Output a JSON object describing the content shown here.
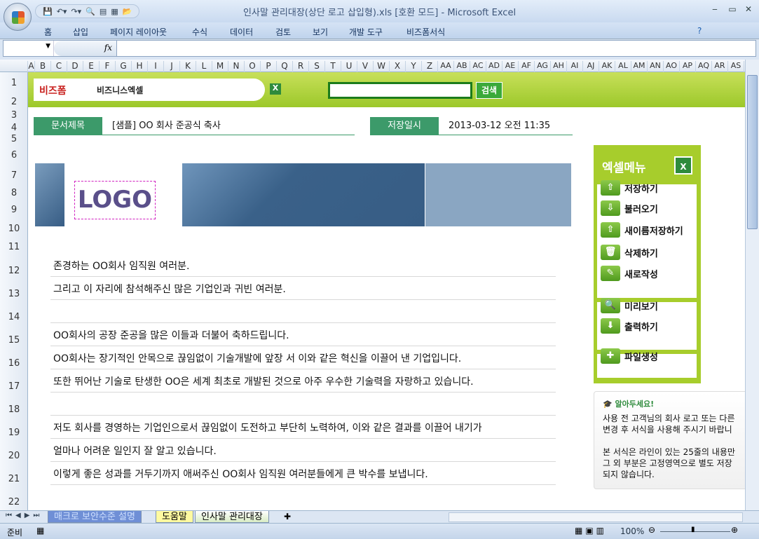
{
  "window": {
    "title": "인사말 관리대장(상단 로고 삽입형).xls  [호환 모드] - Microsoft Excel",
    "min": "‒",
    "max": "▭",
    "close": "✕"
  },
  "ribbon": {
    "tabs": [
      "홈",
      "삽입",
      "페이지 레이아웃",
      "수식",
      "데이터",
      "검토",
      "보기",
      "개발 도구",
      "비즈폼서식"
    ]
  },
  "formula_bar": {
    "name_box": "",
    "fx": "fx",
    "value": ""
  },
  "columns": [
    "A",
    "B",
    "C",
    "D",
    "E",
    "F",
    "G",
    "H",
    "I",
    "J",
    "K",
    "L",
    "M",
    "N",
    "O",
    "P",
    "Q",
    "R",
    "S",
    "T",
    "U",
    "V",
    "W",
    "X",
    "Y",
    "Z",
    "AA",
    "AB",
    "AC",
    "AD",
    "AE",
    "AF",
    "AG",
    "AH",
    "AI",
    "AJ",
    "AK",
    "AL",
    "AM",
    "AN",
    "AO",
    "AP",
    "AQ",
    "AR",
    "AS"
  ],
  "rows": [
    "1",
    "2",
    "3",
    "4",
    "5",
    "6",
    "7",
    "8",
    "9",
    "10",
    "11",
    "12",
    "13",
    "14",
    "15",
    "16",
    "17",
    "18",
    "19",
    "20",
    "21",
    "22"
  ],
  "banner": {
    "brand": "비즈폼",
    "brand2": "비즈니스엑셀",
    "title": "엑셀데이터 서식",
    "search_value": "",
    "search_button": "검색"
  },
  "doc": {
    "title_label": "문서제목",
    "title_value": "[샘플] OO 회사 준공식 축사",
    "date_label": "저장일시",
    "date_value": "2013-03-12  오전 11:35",
    "logo": "LOGO"
  },
  "lines": [
    "존경하는 OO회사 임직원 여러분.",
    "그리고 이 자리에 참석해주신 많은 기업인과 귀빈 여러분.",
    "",
    "OO회사의 공장 준공을 많은 이들과 더불어 축하드립니다.",
    "OO회사는 장기적인 안목으로 끊임없이 기술개발에 앞장 서 이와 같은 혁신을 이끌어 낸 기업입니다.",
    "또한 뛰어난 기술로 탄생한 OO은 세계 최초로 개발된 것으로 아주 우수한 기술력을 자랑하고 있습니다.",
    "",
    "저도 회사를 경영하는 기업인으로서 끊임없이 도전하고 부단히 노력하여, 이와 같은 결과를 이끌어 내기가",
    "얼마나 어려운 일인지 잘 알고 있습니다.",
    "이렇게 좋은 성과를 거두기까지 애써주신 OO회사 임직원 여러분들에게 큰 박수를 보냅니다."
  ],
  "menu": {
    "title": "엑셀메뉴",
    "items": [
      "저장하기",
      "불러오기",
      "새이름저장하기",
      "삭제하기",
      "새로작성",
      "미리보기",
      "출력하기",
      "파일생성"
    ]
  },
  "notice": {
    "title": "알아두세요!",
    "p1a": "사용 전 고객님의 회사 로고 또는 다른",
    "p1b": "변경 후 서식을 사용해 주시기 바랍니",
    "p2a": "본 서식은 라인이 있는 25줄의 내용만",
    "p2b": "그 외 부분은 고정영역으로 별도 저장",
    "p2c": "되지 않습니다."
  },
  "sheet_tabs": [
    "매크로 보안수준 설명",
    "도움말",
    "인사말 관리대장"
  ],
  "status": {
    "ready": "준비",
    "zoom": "100%"
  },
  "colors": {
    "green": "#3c9a6a",
    "menu": "#a7cd2c"
  }
}
